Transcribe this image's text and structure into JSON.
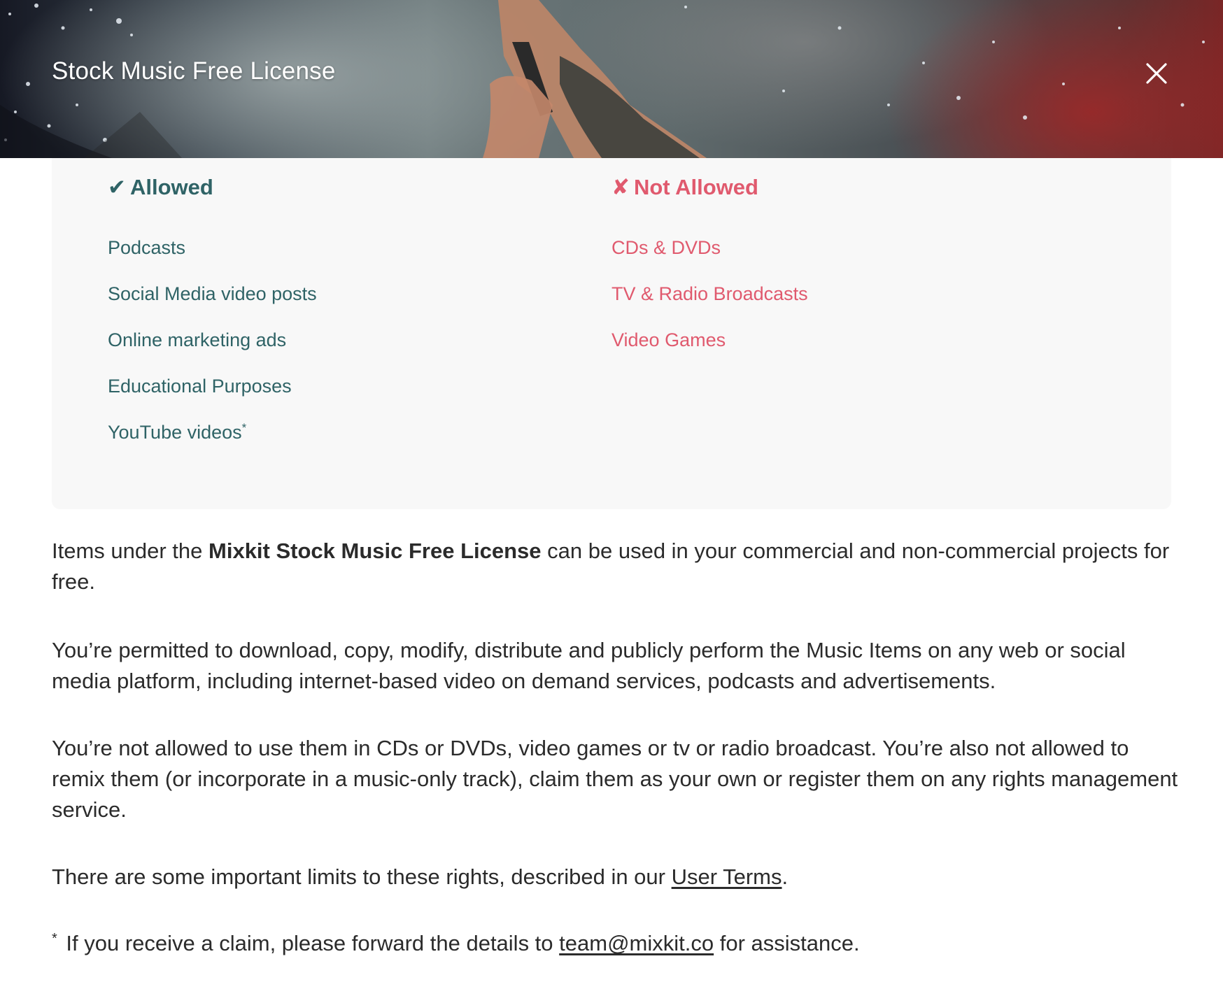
{
  "modal": {
    "title": "Stock Music Free License",
    "close_icon": "close-icon"
  },
  "allowed": {
    "mark": "✔",
    "heading": "Allowed",
    "items": [
      "Podcasts",
      "Social Media video posts",
      "Online marketing ads",
      "Educational Purposes",
      "YouTube videos"
    ],
    "footnote_mark": "*",
    "color": "#2f6366"
  },
  "not_allowed": {
    "mark": "✘",
    "heading": "Not Allowed",
    "items": [
      "CDs & DVDs",
      "TV & Radio Broadcasts",
      "Video Games"
    ],
    "color": "#e05a6e"
  },
  "body": {
    "p1_before": "Items under the ",
    "p1_bold": "Mixkit Stock Music Free License",
    "p1_after": " can be used in your commercial and non-commercial projects for free.",
    "p2": "You’re permitted to download, copy, modify, distribute and publicly perform the Music Items on any web or social media platform, including internet-based video on demand services, podcasts and advertisements.",
    "p3": "You’re not allowed to use them in CDs or DVDs, video games or tv or radio broadcast. You’re also not allowed to remix them (or incorporate in a music-only track), claim them as your own or register them on any rights management service.",
    "p4_before": "There are some important limits to these rights, described in our ",
    "p4_link": "User Terms",
    "p4_after": ".",
    "footnote_star": "*",
    "footnote_before": " If you receive a claim, please forward the details to ",
    "footnote_link": "team@mixkit.co",
    "footnote_after": " for assistance."
  }
}
